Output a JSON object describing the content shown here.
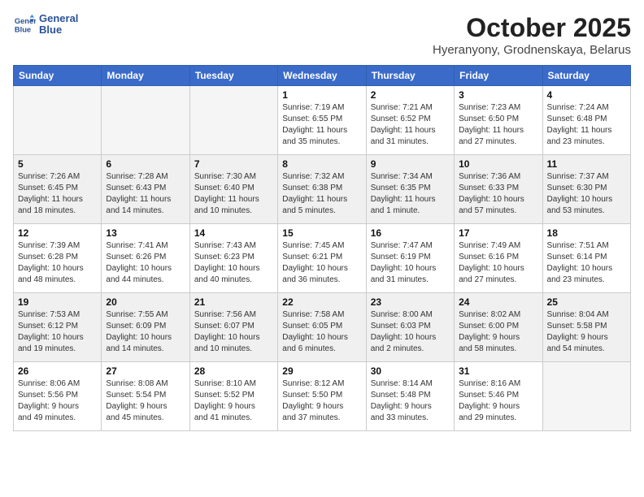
{
  "header": {
    "logo_line1": "General",
    "logo_line2": "Blue",
    "month": "October 2025",
    "location": "Hyeranyony, Grodnenskaya, Belarus"
  },
  "weekdays": [
    "Sunday",
    "Monday",
    "Tuesday",
    "Wednesday",
    "Thursday",
    "Friday",
    "Saturday"
  ],
  "weeks": [
    [
      {
        "day": "",
        "info": ""
      },
      {
        "day": "",
        "info": ""
      },
      {
        "day": "",
        "info": ""
      },
      {
        "day": "1",
        "info": "Sunrise: 7:19 AM\nSunset: 6:55 PM\nDaylight: 11 hours\nand 35 minutes."
      },
      {
        "day": "2",
        "info": "Sunrise: 7:21 AM\nSunset: 6:52 PM\nDaylight: 11 hours\nand 31 minutes."
      },
      {
        "day": "3",
        "info": "Sunrise: 7:23 AM\nSunset: 6:50 PM\nDaylight: 11 hours\nand 27 minutes."
      },
      {
        "day": "4",
        "info": "Sunrise: 7:24 AM\nSunset: 6:48 PM\nDaylight: 11 hours\nand 23 minutes."
      }
    ],
    [
      {
        "day": "5",
        "info": "Sunrise: 7:26 AM\nSunset: 6:45 PM\nDaylight: 11 hours\nand 18 minutes."
      },
      {
        "day": "6",
        "info": "Sunrise: 7:28 AM\nSunset: 6:43 PM\nDaylight: 11 hours\nand 14 minutes."
      },
      {
        "day": "7",
        "info": "Sunrise: 7:30 AM\nSunset: 6:40 PM\nDaylight: 11 hours\nand 10 minutes."
      },
      {
        "day": "8",
        "info": "Sunrise: 7:32 AM\nSunset: 6:38 PM\nDaylight: 11 hours\nand 5 minutes."
      },
      {
        "day": "9",
        "info": "Sunrise: 7:34 AM\nSunset: 6:35 PM\nDaylight: 11 hours\nand 1 minute."
      },
      {
        "day": "10",
        "info": "Sunrise: 7:36 AM\nSunset: 6:33 PM\nDaylight: 10 hours\nand 57 minutes."
      },
      {
        "day": "11",
        "info": "Sunrise: 7:37 AM\nSunset: 6:30 PM\nDaylight: 10 hours\nand 53 minutes."
      }
    ],
    [
      {
        "day": "12",
        "info": "Sunrise: 7:39 AM\nSunset: 6:28 PM\nDaylight: 10 hours\nand 48 minutes."
      },
      {
        "day": "13",
        "info": "Sunrise: 7:41 AM\nSunset: 6:26 PM\nDaylight: 10 hours\nand 44 minutes."
      },
      {
        "day": "14",
        "info": "Sunrise: 7:43 AM\nSunset: 6:23 PM\nDaylight: 10 hours\nand 40 minutes."
      },
      {
        "day": "15",
        "info": "Sunrise: 7:45 AM\nSunset: 6:21 PM\nDaylight: 10 hours\nand 36 minutes."
      },
      {
        "day": "16",
        "info": "Sunrise: 7:47 AM\nSunset: 6:19 PM\nDaylight: 10 hours\nand 31 minutes."
      },
      {
        "day": "17",
        "info": "Sunrise: 7:49 AM\nSunset: 6:16 PM\nDaylight: 10 hours\nand 27 minutes."
      },
      {
        "day": "18",
        "info": "Sunrise: 7:51 AM\nSunset: 6:14 PM\nDaylight: 10 hours\nand 23 minutes."
      }
    ],
    [
      {
        "day": "19",
        "info": "Sunrise: 7:53 AM\nSunset: 6:12 PM\nDaylight: 10 hours\nand 19 minutes."
      },
      {
        "day": "20",
        "info": "Sunrise: 7:55 AM\nSunset: 6:09 PM\nDaylight: 10 hours\nand 14 minutes."
      },
      {
        "day": "21",
        "info": "Sunrise: 7:56 AM\nSunset: 6:07 PM\nDaylight: 10 hours\nand 10 minutes."
      },
      {
        "day": "22",
        "info": "Sunrise: 7:58 AM\nSunset: 6:05 PM\nDaylight: 10 hours\nand 6 minutes."
      },
      {
        "day": "23",
        "info": "Sunrise: 8:00 AM\nSunset: 6:03 PM\nDaylight: 10 hours\nand 2 minutes."
      },
      {
        "day": "24",
        "info": "Sunrise: 8:02 AM\nSunset: 6:00 PM\nDaylight: 9 hours\nand 58 minutes."
      },
      {
        "day": "25",
        "info": "Sunrise: 8:04 AM\nSunset: 5:58 PM\nDaylight: 9 hours\nand 54 minutes."
      }
    ],
    [
      {
        "day": "26",
        "info": "Sunrise: 8:06 AM\nSunset: 5:56 PM\nDaylight: 9 hours\nand 49 minutes."
      },
      {
        "day": "27",
        "info": "Sunrise: 8:08 AM\nSunset: 5:54 PM\nDaylight: 9 hours\nand 45 minutes."
      },
      {
        "day": "28",
        "info": "Sunrise: 8:10 AM\nSunset: 5:52 PM\nDaylight: 9 hours\nand 41 minutes."
      },
      {
        "day": "29",
        "info": "Sunrise: 8:12 AM\nSunset: 5:50 PM\nDaylight: 9 hours\nand 37 minutes."
      },
      {
        "day": "30",
        "info": "Sunrise: 8:14 AM\nSunset: 5:48 PM\nDaylight: 9 hours\nand 33 minutes."
      },
      {
        "day": "31",
        "info": "Sunrise: 8:16 AM\nSunset: 5:46 PM\nDaylight: 9 hours\nand 29 minutes."
      },
      {
        "day": "",
        "info": ""
      }
    ]
  ]
}
